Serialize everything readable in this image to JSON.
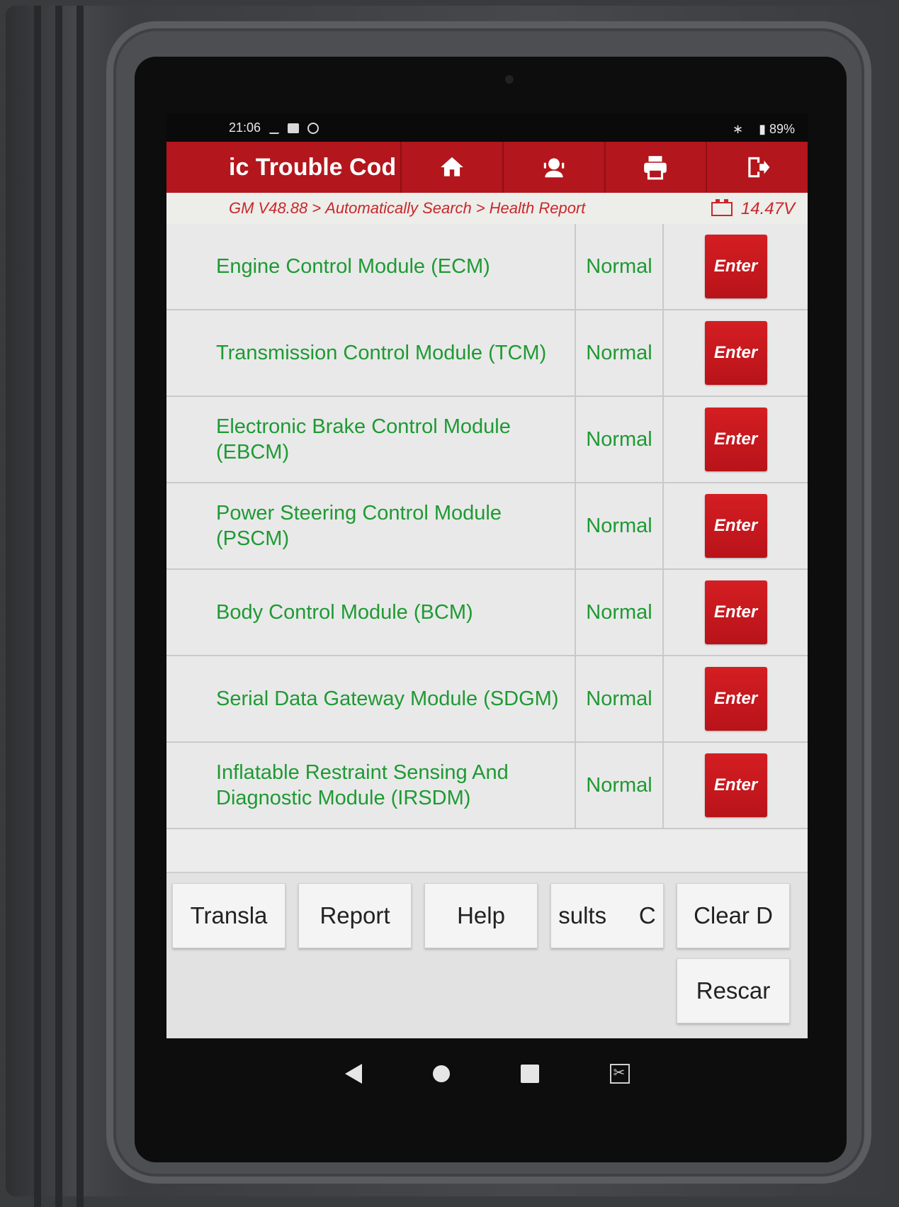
{
  "status_bar": {
    "time": "21:06",
    "battery": "89%"
  },
  "title_bar": {
    "title": "ic Trouble Cod",
    "buttons": [
      {
        "icon": "home-icon"
      },
      {
        "icon": "support-agent-icon"
      },
      {
        "icon": "printer-icon"
      },
      {
        "icon": "exit-icon"
      }
    ]
  },
  "breadcrumb": {
    "items": [
      "GM V48.88",
      "Automatically Search",
      "Health Report"
    ],
    "separator": ">",
    "voltage": "14.47V"
  },
  "modules": [
    {
      "name": "Engine Control Module (ECM)",
      "status": "Normal",
      "action": "Enter"
    },
    {
      "name": "Transmission Control Module (TCM)",
      "status": "Normal",
      "action": "Enter"
    },
    {
      "name": "Electronic Brake Control Module (EBCM)",
      "status": "Normal",
      "action": "Enter"
    },
    {
      "name": "Power Steering Control Module (PSCM)",
      "status": "Normal",
      "action": "Enter"
    },
    {
      "name": "Body Control Module (BCM)",
      "status": "Normal",
      "action": "Enter"
    },
    {
      "name": "Serial Data Gateway Module (SDGM)",
      "status": "Normal",
      "action": "Enter"
    },
    {
      "name": "Inflatable Restraint Sensing And Diagnostic Module (IRSDM)",
      "status": "Normal",
      "action": "Enter"
    }
  ],
  "bottom_buttons": {
    "translate": "Transla",
    "report": "Report",
    "help": "Help",
    "results": "sults     C",
    "clear": "Clear D",
    "rescan": "Rescar"
  },
  "colors": {
    "accent_red": "#b3161c",
    "module_green": "#1e9a33",
    "breadcrumb_red": "#c8282a"
  }
}
